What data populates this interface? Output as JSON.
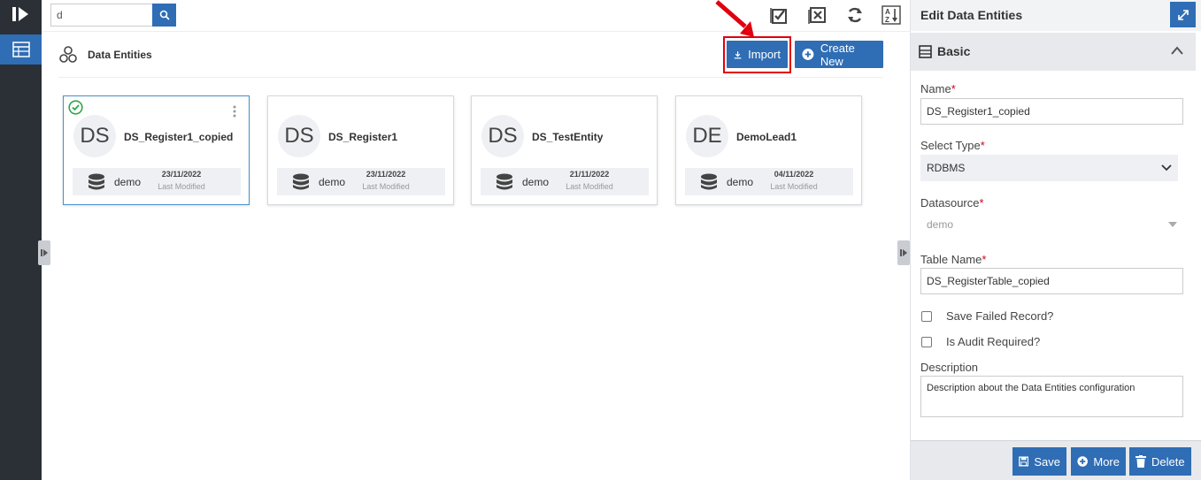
{
  "search": {
    "value": "d"
  },
  "page": {
    "title": "Data Entities"
  },
  "actions": {
    "import_label": "Import",
    "create_label": "Create New"
  },
  "cards": [
    {
      "initials": "DS",
      "name": "DS_Register1_copied",
      "datasource": "demo",
      "date": "23/11/2022",
      "date_caption": "Last Modified",
      "selected": true
    },
    {
      "initials": "DS",
      "name": "DS_Register1",
      "datasource": "demo",
      "date": "23/11/2022",
      "date_caption": "Last Modified",
      "selected": false
    },
    {
      "initials": "DS",
      "name": "DS_TestEntity",
      "datasource": "demo",
      "date": "21/11/2022",
      "date_caption": "Last Modified",
      "selected": false
    },
    {
      "initials": "DE",
      "name": "DemoLead1",
      "datasource": "demo",
      "date": "04/11/2022",
      "date_caption": "Last Modified",
      "selected": false
    }
  ],
  "panel": {
    "title": "Edit Data Entities",
    "section": "Basic",
    "name_label": "Name",
    "name_value": "DS_Register1_copied",
    "type_label": "Select Type",
    "type_value": "RDBMS",
    "datasource_label": "Datasource",
    "datasource_value": "demo",
    "table_label": "Table Name",
    "table_value": "DS_RegisterTable_copied",
    "save_failed_label": "Save Failed Record?",
    "audit_label": "Is Audit Required?",
    "description_label": "Description",
    "description_value": "Description about the Data Entities configuration",
    "save_label": "Save",
    "more_label": "More",
    "delete_label": "Delete",
    "required_mark": "*"
  },
  "colors": {
    "primary": "#2f6db5",
    "rail": "#2b2f36",
    "highlight": "#e0000f",
    "success": "#2aa84a"
  }
}
